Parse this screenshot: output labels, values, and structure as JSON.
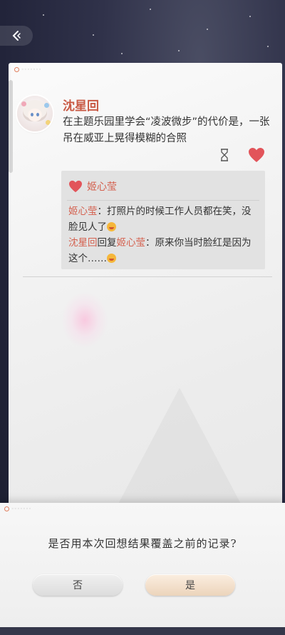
{
  "post": {
    "author": "沈星回",
    "content": "在主题乐园里学会“凌波微步”的代价是，一张吊在威亚上晃得模糊的合照"
  },
  "likes": {
    "user": "姬心莹"
  },
  "comments": [
    {
      "author": "姬心莹",
      "separator": "：",
      "text": "打照片的时候工作人员都在笑，没脸见人了"
    },
    {
      "author": "沈星回",
      "reply_word": "回复",
      "reply_to": "姬心莹",
      "separator": "：",
      "text": "原来你当时脸红是因为这个……"
    }
  ],
  "dialog": {
    "question": "是否用本次回想结果覆盖之前的记录?",
    "no_label": "否",
    "yes_label": "是"
  },
  "icons": {
    "back": "back-arrow-icon",
    "hourglass": "hourglass-icon",
    "heart": "heart-icon",
    "emoji": "emoji-icon"
  },
  "colors": {
    "name_accent": "#c95a45",
    "heart": "#e2545a",
    "comment_name": "#d4604e"
  }
}
